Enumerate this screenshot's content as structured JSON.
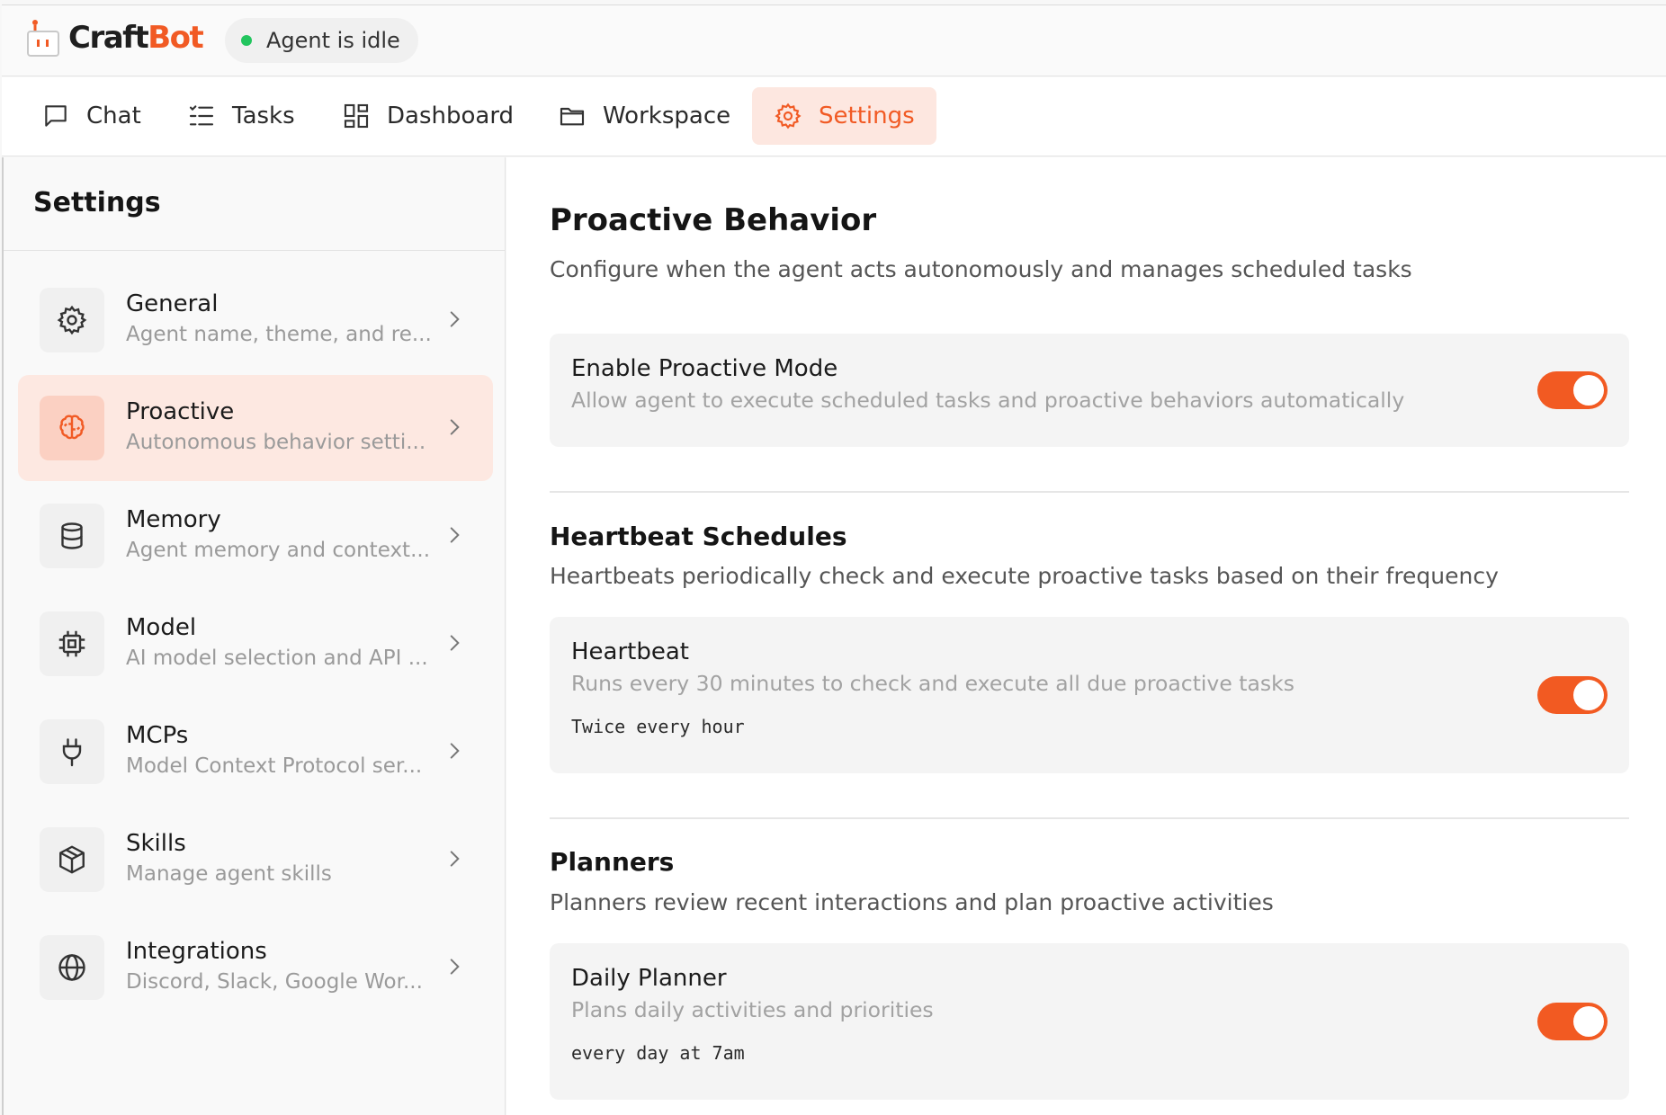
{
  "app": {
    "name_part1": "Craft",
    "name_part2": "Bot",
    "status": "Agent is idle",
    "accent_color": "#f15a24",
    "status_color": "#22c55e"
  },
  "nav": {
    "tabs": [
      {
        "label": "Chat",
        "icon": "chat-icon"
      },
      {
        "label": "Tasks",
        "icon": "tasks-icon"
      },
      {
        "label": "Dashboard",
        "icon": "dashboard-icon"
      },
      {
        "label": "Workspace",
        "icon": "folder-icon"
      },
      {
        "label": "Settings",
        "icon": "gear-icon",
        "active": true
      }
    ]
  },
  "sidebar": {
    "title": "Settings",
    "items": [
      {
        "label": "General",
        "desc": "Agent name, theme, and re...",
        "icon": "gear-icon"
      },
      {
        "label": "Proactive",
        "desc": "Autonomous behavior setti...",
        "icon": "brain-icon",
        "active": true
      },
      {
        "label": "Memory",
        "desc": "Agent memory and context...",
        "icon": "database-icon"
      },
      {
        "label": "Model",
        "desc": "AI model selection and API ...",
        "icon": "cpu-icon"
      },
      {
        "label": "MCPs",
        "desc": "Model Context Protocol ser...",
        "icon": "plug-icon"
      },
      {
        "label": "Skills",
        "desc": "Manage agent skills",
        "icon": "package-icon"
      },
      {
        "label": "Integrations",
        "desc": "Discord, Slack, Google Wor...",
        "icon": "globe-icon"
      }
    ]
  },
  "main": {
    "title": "Proactive Behavior",
    "subtitle": "Configure when the agent acts autonomously and manages scheduled tasks",
    "proactive_mode": {
      "title": "Enable Proactive Mode",
      "desc": "Allow agent to execute scheduled tasks and proactive behaviors automatically",
      "enabled": true
    },
    "heartbeat_section": {
      "title": "Heartbeat Schedules",
      "subtitle": "Heartbeats periodically check and execute proactive tasks based on their frequency",
      "card": {
        "title": "Heartbeat",
        "desc": "Runs every 30 minutes to check and execute all due proactive tasks",
        "schedule": "Twice every hour",
        "enabled": true
      }
    },
    "planners_section": {
      "title": "Planners",
      "subtitle": "Planners review recent interactions and plan proactive activities",
      "card": {
        "title": "Daily Planner",
        "desc": "Plans daily activities and priorities",
        "schedule": "every day at 7am",
        "enabled": true
      }
    }
  }
}
